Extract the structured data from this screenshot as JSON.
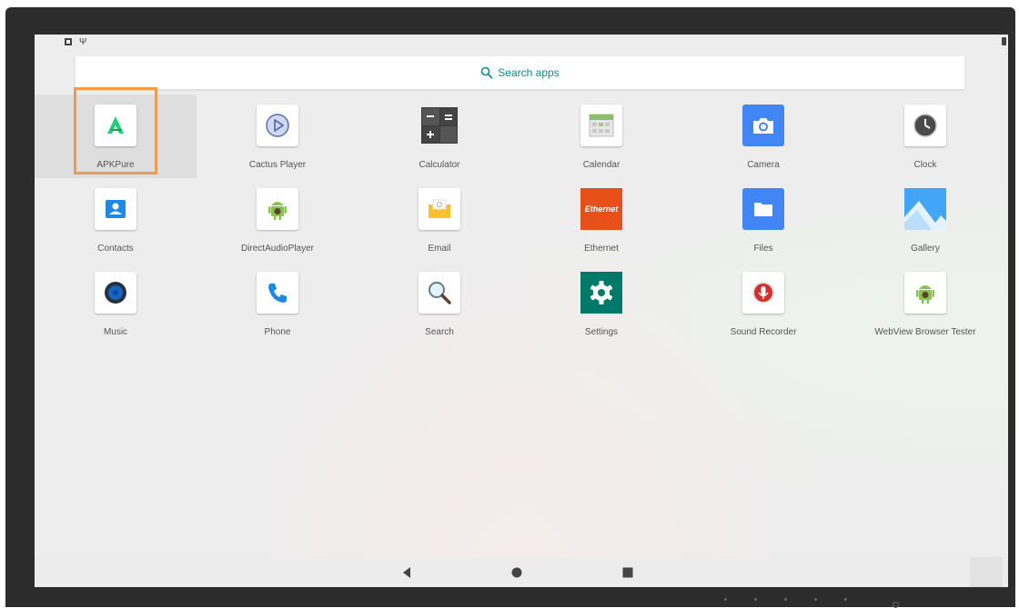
{
  "search": {
    "label": "Search apps",
    "icon": "search-icon"
  },
  "status_bar": {
    "icons": [
      "notification-icon",
      "usb-icon",
      "battery-icon"
    ]
  },
  "apps": [
    {
      "label": "APKPure",
      "icon": "apkpure-icon"
    },
    {
      "label": "Cactus Player",
      "icon": "cactus-player-icon"
    },
    {
      "label": "Calculator",
      "icon": "calculator-icon"
    },
    {
      "label": "Calendar",
      "icon": "calendar-icon"
    },
    {
      "label": "Camera",
      "icon": "camera-icon"
    },
    {
      "label": "Clock",
      "icon": "clock-icon"
    },
    {
      "label": "Contacts",
      "icon": "contacts-icon"
    },
    {
      "label": "DirectAudioPlayer",
      "icon": "android-icon"
    },
    {
      "label": "Email",
      "icon": "email-icon"
    },
    {
      "label": "Ethernet",
      "icon": "ethernet-icon",
      "icon_text": "Ethernet"
    },
    {
      "label": "Files",
      "icon": "folder-icon"
    },
    {
      "label": "Gallery",
      "icon": "gallery-icon"
    },
    {
      "label": "Music",
      "icon": "music-icon"
    },
    {
      "label": "Phone",
      "icon": "phone-icon"
    },
    {
      "label": "Search",
      "icon": "magnifier-icon"
    },
    {
      "label": "Settings",
      "icon": "settings-gear-icon"
    },
    {
      "label": "Sound Recorder",
      "icon": "microphone-icon"
    },
    {
      "label": "WebView Browser Tester",
      "icon": "android-icon"
    }
  ],
  "selected_app": "APKPure",
  "nav_bar": [
    "back-icon",
    "home-icon",
    "recents-icon"
  ],
  "colors": {
    "search_text": "#0f8b8d",
    "highlight": "#f39a4a",
    "camera": "#4285f4",
    "settings": "#00796b",
    "ethernet": "#e8501a"
  }
}
